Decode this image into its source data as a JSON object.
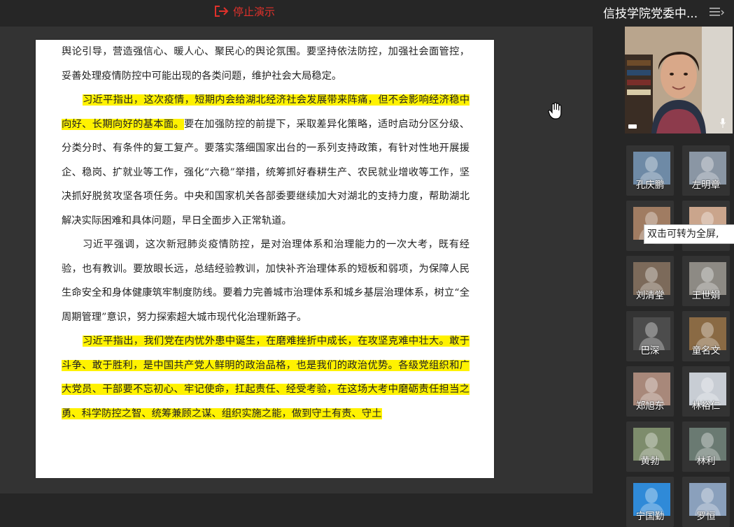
{
  "toolbar": {
    "stop_label": "停止演示"
  },
  "meeting": {
    "title": "信技学院党委中..."
  },
  "document": {
    "paragraphs": [
      {
        "text": "舆论引导，营造强信心、暖人心、聚民心的舆论氛围。要坚持依法防控，加强社会面管控，妥善处理疫情防控中可能出现的各类问题，维护社会大局稳定。",
        "highlight": "",
        "rest": ""
      },
      {
        "highlight": "习近平指出，这次疫情，短期内会给湖北经济社会发展带来阵痛，但不会影响经济稳中向好、长期向好的基本面。",
        "rest": "要在加强防控的前提下，采取差异化策略，适时启动分区分级、分类分时、有条件的复工复产。要落实落细国家出台的一系列支持政策，有针对性地开展援企、稳岗、扩就业等工作，强化“六稳”举措，统筹抓好春耕生产、农民就业增收等工作，坚决抓好脱贫攻坚各项任务。中央和国家机关各部委要继续加大对湖北的支持力度，帮助湖北解决实际困难和具体问题，早日全面步入正常轨道。"
      },
      {
        "text": "习近平强调，这次新冠肺炎疫情防控，是对治理体系和治理能力的一次大考，既有经验，也有教训。要放眼长远，总结经验教训，加快补齐治理体系的短板和弱项，为保障人民生命安全和身体健康筑牢制度防线。要着力完善城市治理体系和城乡基层治理体系，树立“全周期管理”意识，努力探索超大城市现代化治理新路子。"
      },
      {
        "highlight": "习近平指出，我们党在内忧外患中诞生，在磨难挫折中成长，在攻坚克难中壮大。敢于斗争、敢于胜利，是中国共产党人鲜明的政治品格，也是我们的政治优势。各级党组织和广大党员、干部要不忘初心、牢记使命，扛起责任、经受考验，在这场大考中磨砺责任担当之勇、科学防控之智、统筹兼顾之谋、组织实施之能，做到守土有责、守土"
      }
    ]
  },
  "tooltip": {
    "text": "双击可转为全屏,"
  },
  "participants": [
    {
      "name": "孔庆鹏",
      "bg": "#6e8aa6"
    },
    {
      "name": "左明章",
      "bg": "#8a96a4"
    },
    {
      "name": "王",
      "bg": "#a07c62"
    },
    {
      "name": "",
      "bg": "#caa58c"
    },
    {
      "name": "刘清堂",
      "bg": "#7c6a5a"
    },
    {
      "name": "王世娟",
      "bg": "#8d8a84"
    },
    {
      "name": "巴深",
      "bg": "#4c4c4c"
    },
    {
      "name": "童名文",
      "bg": "#8a6a44"
    },
    {
      "name": "郑旭东",
      "bg": "#a8887a"
    },
    {
      "name": "林裕仁",
      "bg": "#c8cdd4"
    },
    {
      "name": "黄勃",
      "bg": "#7d8c6c"
    },
    {
      "name": "林利",
      "bg": "#6a7a72"
    },
    {
      "name": "宁国勤",
      "bg": "#2f8ad8"
    },
    {
      "name": "罗恒",
      "bg": "#8aa0bc"
    }
  ],
  "colors": {
    "highlight": "#fff200",
    "stop_red": "#e0312b",
    "panel": "#333333"
  }
}
